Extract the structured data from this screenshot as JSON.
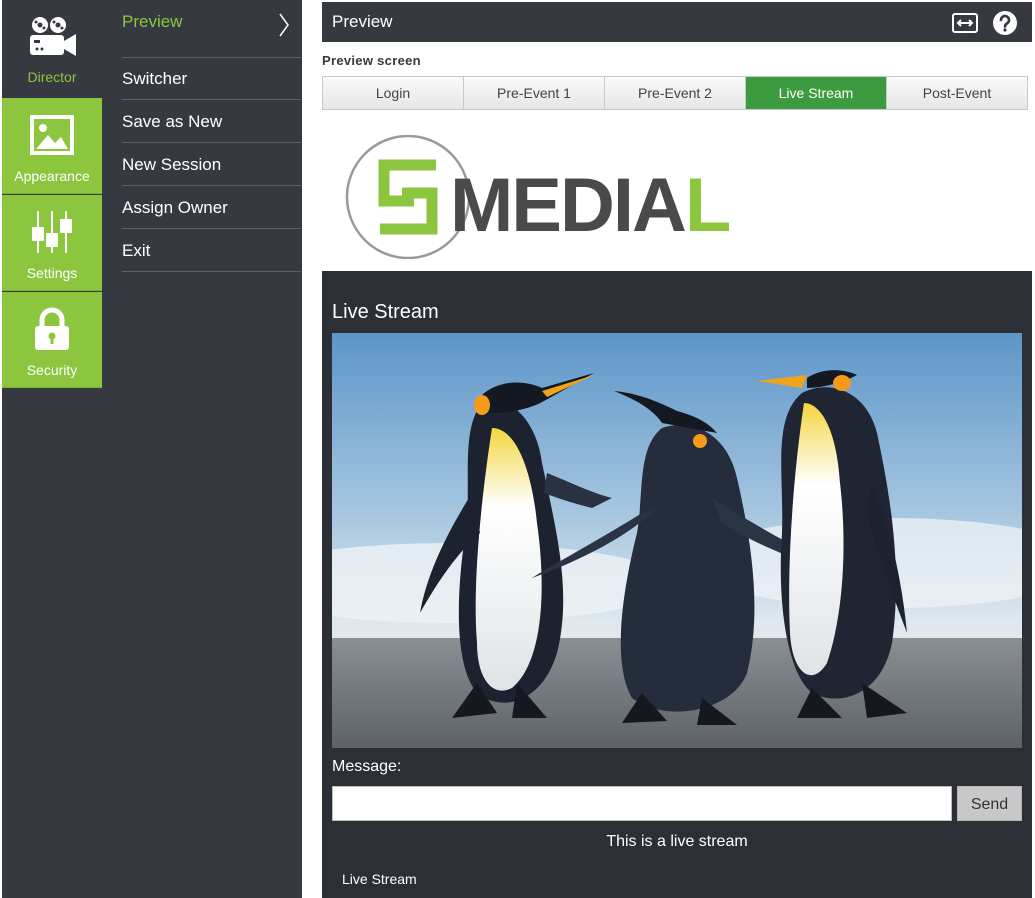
{
  "rail": {
    "items": [
      {
        "label": "Director",
        "icon": "movie-camera-icon",
        "active": true
      },
      {
        "label": "Appearance",
        "icon": "image-icon"
      },
      {
        "label": "Settings",
        "icon": "sliders-icon"
      },
      {
        "label": "Security",
        "icon": "lock-icon"
      }
    ]
  },
  "submenu": {
    "items": [
      {
        "label": "Preview",
        "active": true
      },
      {
        "label": "Switcher"
      },
      {
        "label": "Save as New"
      },
      {
        "label": "New Session"
      },
      {
        "label": "Assign Owner"
      },
      {
        "label": "Exit"
      }
    ]
  },
  "header": {
    "title": "Preview",
    "icons": [
      "expand-horizontal-icon",
      "help-icon"
    ]
  },
  "preview": {
    "label": "Preview screen",
    "tabs": [
      {
        "label": "Login"
      },
      {
        "label": "Pre-Event 1"
      },
      {
        "label": "Pre-Event 2"
      },
      {
        "label": "Live Stream",
        "active": true
      },
      {
        "label": "Post-Event"
      }
    ]
  },
  "logo": {
    "text_before": "MEDIA",
    "text_accent": "L"
  },
  "stage": {
    "title": "Live Stream",
    "message_label": "Message:",
    "message_value": "",
    "send_label": "Send",
    "caption": "This is a live stream",
    "footer": "Live Stream"
  },
  "colors": {
    "accent_green": "#8cc63f",
    "active_tab": "#3c9a3f",
    "dark_panel": "#363a40",
    "stage_bg": "#2c2f36"
  }
}
